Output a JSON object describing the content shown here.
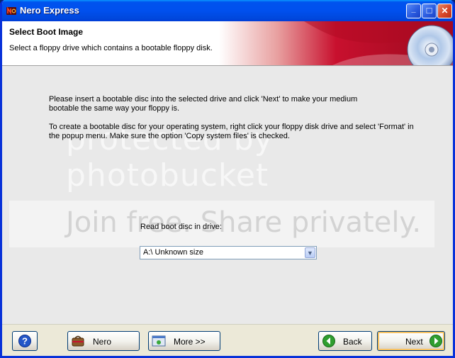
{
  "window": {
    "title": "Nero Express"
  },
  "titlebar": {
    "minimize_glyph": "_",
    "maximize_glyph": "□",
    "close_glyph": "✕"
  },
  "header": {
    "title": "Select Boot Image",
    "subtitle": "Select a floppy drive which contains a bootable floppy disk."
  },
  "content": {
    "para1_line1": "Please insert a bootable disc into the selected drive and click 'Next' to make your medium",
    "para1_line2": "bootable the same way your floppy is.",
    "para2_line1": "To create a bootable disc for your operating system, right click your floppy disk drive and select 'Format' in",
    "para2_line2": "the popup menu. Make sure the option 'Copy system files' is checked.",
    "watermark_top": "protected by photobucket",
    "watermark_bottom": "Join free. Share privately.",
    "drive_label": "Read boot disc in drive:",
    "drive_value": "A:\\  Unknown size"
  },
  "footer": {
    "nero_label": "Nero",
    "more_label": "More >>",
    "back_label": "Back",
    "next_label": "Next"
  },
  "icons": {
    "app": "nero-icon",
    "help": "help-icon",
    "nero": "nero-bag-icon",
    "more": "more-options-icon",
    "back": "back-arrow-icon",
    "next": "next-arrow-icon"
  },
  "colors": {
    "titlebar": "#0053ee",
    "header_accent": "#c8102e",
    "back_arrow": "#2f9e2f",
    "next_arrow": "#2f9e2f"
  }
}
